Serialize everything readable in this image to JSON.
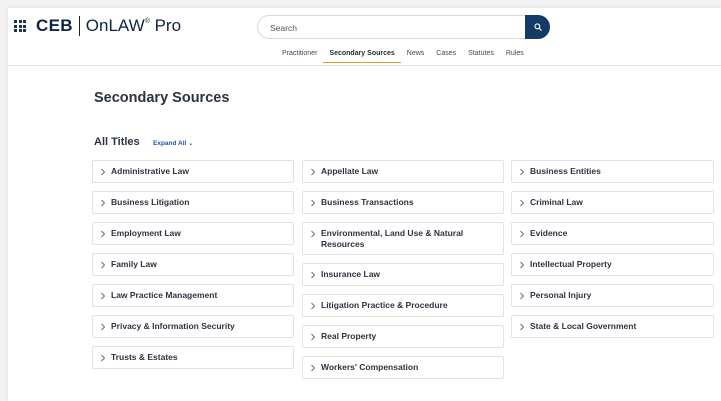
{
  "header": {
    "logo_brand": "CEB",
    "logo_product": "OnLAW",
    "logo_reg": "®",
    "logo_suffix": "Pro",
    "search_placeholder": "Search"
  },
  "tabs": [
    {
      "label": "Practitioner",
      "active": false
    },
    {
      "label": "Secondary Sources",
      "active": true
    },
    {
      "label": "News",
      "active": false
    },
    {
      "label": "Cases",
      "active": false
    },
    {
      "label": "Statutes",
      "active": false
    },
    {
      "label": "Rules",
      "active": false
    }
  ],
  "main": {
    "title": "Secondary Sources",
    "section_title": "All Titles",
    "expand_label": "Expand All ⌄"
  },
  "columns": [
    [
      "Administrative Law",
      "Business Litigation",
      "Employment Law",
      "Family Law",
      "Law Practice Management",
      "Privacy & Information Security",
      "Trusts & Estates"
    ],
    [
      "Appellate Law",
      "Business Transactions",
      "Environmental, Land Use & Natural Resources",
      "Insurance Law",
      "Litigation Practice & Procedure",
      "Real Property",
      "Workers' Compensation"
    ],
    [
      "Business Entities",
      "Criminal Law",
      "Evidence",
      "Intellectual Property",
      "Personal Injury",
      "State & Local Government"
    ]
  ],
  "colors": {
    "brand": "#0f2440",
    "search_button": "#163a66",
    "active_tab_underline": "#e39b2d",
    "link": "#2356a0"
  }
}
